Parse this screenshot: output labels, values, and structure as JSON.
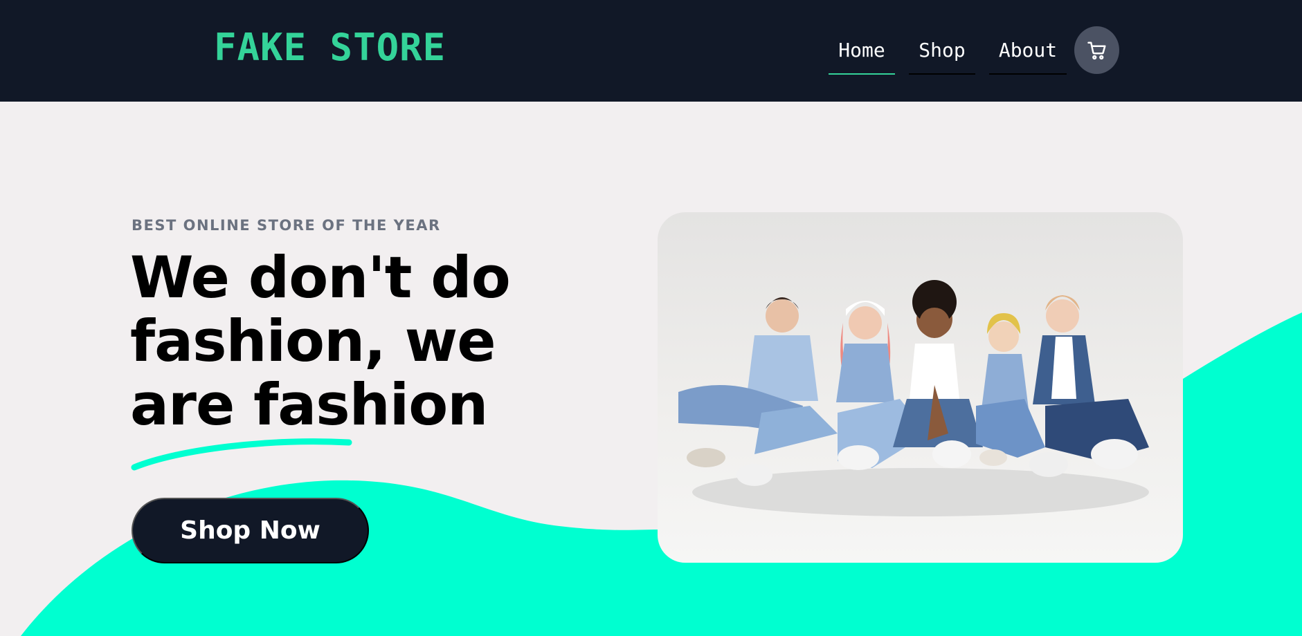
{
  "navbar": {
    "logo": "FAKE STORE",
    "links": [
      {
        "label": "Home",
        "active": true
      },
      {
        "label": "Shop",
        "active": false
      },
      {
        "label": "About",
        "active": false
      }
    ],
    "cart_icon": "cart-icon"
  },
  "hero": {
    "eyebrow": "BEST ONLINE STORE OF THE YEAR",
    "headline": "We don't do fashion, we are fashion",
    "cta_label": "Shop Now",
    "image_description_icon": "group-photo"
  },
  "colors": {
    "navbar_bg": "#111827",
    "logo": "#34d399",
    "accent_wave": "#00ffd0",
    "page_bg": "#f2eff0",
    "button_bg": "#111827"
  }
}
